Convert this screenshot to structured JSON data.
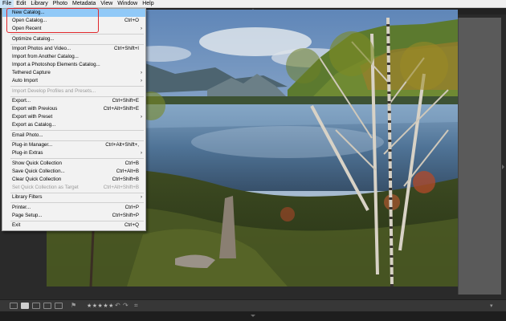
{
  "menubar": {
    "items": [
      "File",
      "Edit",
      "Library",
      "Photo",
      "Metadata",
      "View",
      "Window",
      "Help"
    ]
  },
  "file_menu": {
    "items": [
      {
        "label": "New Catalog...",
        "shortcut": "",
        "submenu": false,
        "disabled": false,
        "highlighted": true
      },
      {
        "label": "Open Catalog...",
        "shortcut": "Ctrl+O",
        "submenu": false,
        "disabled": false,
        "highlighted": false
      },
      {
        "label": "Open Recent",
        "shortcut": "",
        "submenu": true,
        "disabled": false,
        "highlighted": false
      },
      {
        "separator": true
      },
      {
        "label": "Optimize Catalog...",
        "shortcut": "",
        "submenu": false,
        "disabled": false,
        "highlighted": false
      },
      {
        "separator": true
      },
      {
        "label": "Import Photos and Video...",
        "shortcut": "Ctrl+Shift+I",
        "submenu": false,
        "disabled": false,
        "highlighted": false
      },
      {
        "label": "Import from Another Catalog...",
        "shortcut": "",
        "submenu": false,
        "disabled": false,
        "highlighted": false
      },
      {
        "label": "Import a Photoshop Elements Catalog...",
        "shortcut": "",
        "submenu": false,
        "disabled": false,
        "highlighted": false
      },
      {
        "label": "Tethered Capture",
        "shortcut": "",
        "submenu": true,
        "disabled": false,
        "highlighted": false
      },
      {
        "label": "Auto Import",
        "shortcut": "",
        "submenu": true,
        "disabled": false,
        "highlighted": false
      },
      {
        "separator": true
      },
      {
        "label": "Import Develop Profiles and Presets...",
        "shortcut": "",
        "submenu": false,
        "disabled": true,
        "highlighted": false
      },
      {
        "separator": true
      },
      {
        "label": "Export...",
        "shortcut": "Ctrl+Shift+E",
        "submenu": false,
        "disabled": false,
        "highlighted": false
      },
      {
        "label": "Export with Previous",
        "shortcut": "Ctrl+Alt+Shift+E",
        "submenu": false,
        "disabled": false,
        "highlighted": false
      },
      {
        "label": "Export with Preset",
        "shortcut": "",
        "submenu": true,
        "disabled": false,
        "highlighted": false
      },
      {
        "label": "Export as Catalog...",
        "shortcut": "",
        "submenu": false,
        "disabled": false,
        "highlighted": false
      },
      {
        "separator": true
      },
      {
        "label": "Email Photo...",
        "shortcut": "",
        "submenu": false,
        "disabled": false,
        "highlighted": false
      },
      {
        "separator": true
      },
      {
        "label": "Plug-in Manager...",
        "shortcut": "Ctrl+Alt+Shift+,",
        "submenu": false,
        "disabled": false,
        "highlighted": false
      },
      {
        "label": "Plug-in Extras",
        "shortcut": "",
        "submenu": true,
        "disabled": false,
        "highlighted": false
      },
      {
        "separator": true
      },
      {
        "label": "Show Quick Collection",
        "shortcut": "Ctrl+B",
        "submenu": false,
        "disabled": false,
        "highlighted": false
      },
      {
        "label": "Save Quick Collection...",
        "shortcut": "Ctrl+Alt+B",
        "submenu": false,
        "disabled": false,
        "highlighted": false
      },
      {
        "label": "Clear Quick Collection",
        "shortcut": "Ctrl+Shift+B",
        "submenu": false,
        "disabled": false,
        "highlighted": false
      },
      {
        "label": "Set Quick Collection as Target",
        "shortcut": "Ctrl+Alt+Shift+B",
        "submenu": false,
        "disabled": true,
        "highlighted": false
      },
      {
        "separator": true
      },
      {
        "label": "Library Filters",
        "shortcut": "",
        "submenu": true,
        "disabled": false,
        "highlighted": false
      },
      {
        "separator": true
      },
      {
        "label": "Printer...",
        "shortcut": "Ctrl+P",
        "submenu": false,
        "disabled": false,
        "highlighted": false
      },
      {
        "label": "Page Setup...",
        "shortcut": "Ctrl+Shift+P",
        "submenu": false,
        "disabled": false,
        "highlighted": false
      },
      {
        "separator": true
      },
      {
        "label": "Exit",
        "shortcut": "Ctrl+Q",
        "submenu": false,
        "disabled": false,
        "highlighted": false
      }
    ]
  },
  "toolbar": {
    "rating": "★★★★★",
    "views": [
      "grid-view",
      "loupe-view",
      "compare-view",
      "survey-view",
      "people-view"
    ],
    "selected_view": "loupe-view"
  },
  "colors": {
    "highlight": "#91c9f7",
    "callout": "#e0282c",
    "workspace": "#2a2a2a"
  }
}
